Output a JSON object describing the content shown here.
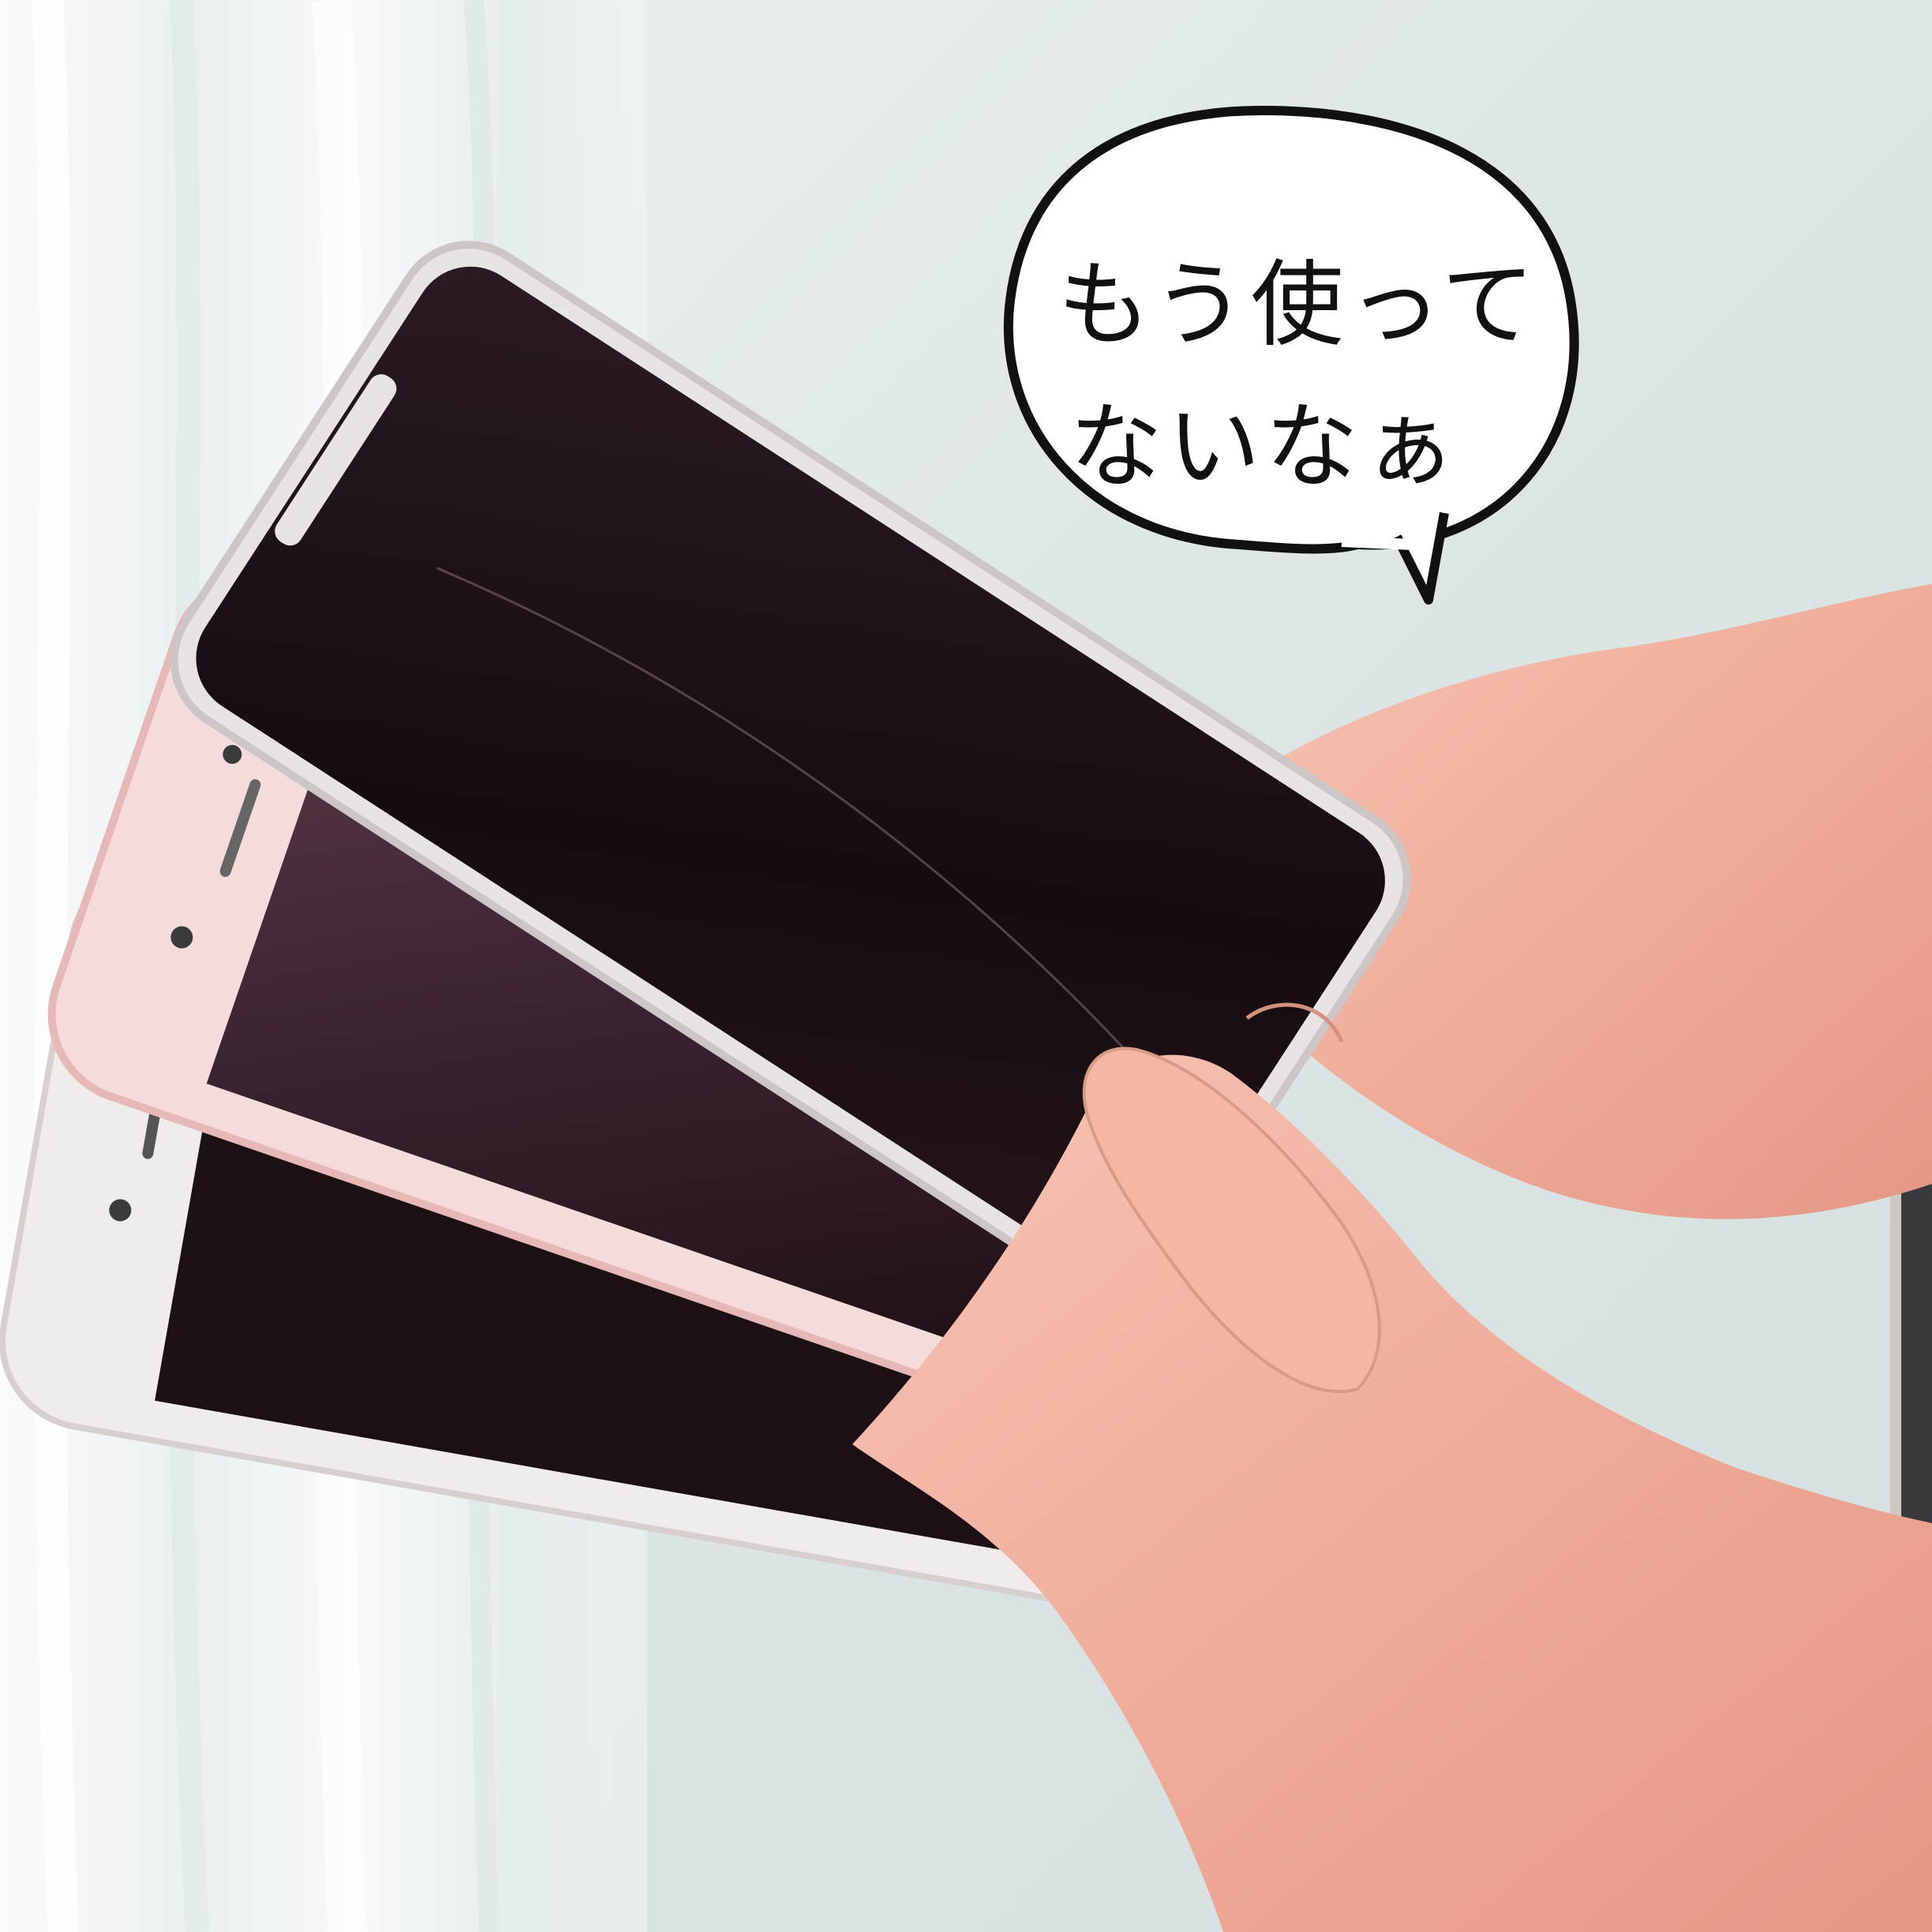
{
  "speech_bubble": {
    "line1": "もう使って",
    "line2": "ないなぁ"
  },
  "colors": {
    "background": "#dfe6e6",
    "curtain": "#f3f6f6",
    "skin": "#f2b3a2",
    "phone_dark_screen": "#1a1014",
    "phone_pink_body": "#f4d8d6",
    "phone_silver_body": "#eeeaea",
    "bubble_fill": "#ffffff",
    "bubble_outline": "#111111"
  }
}
